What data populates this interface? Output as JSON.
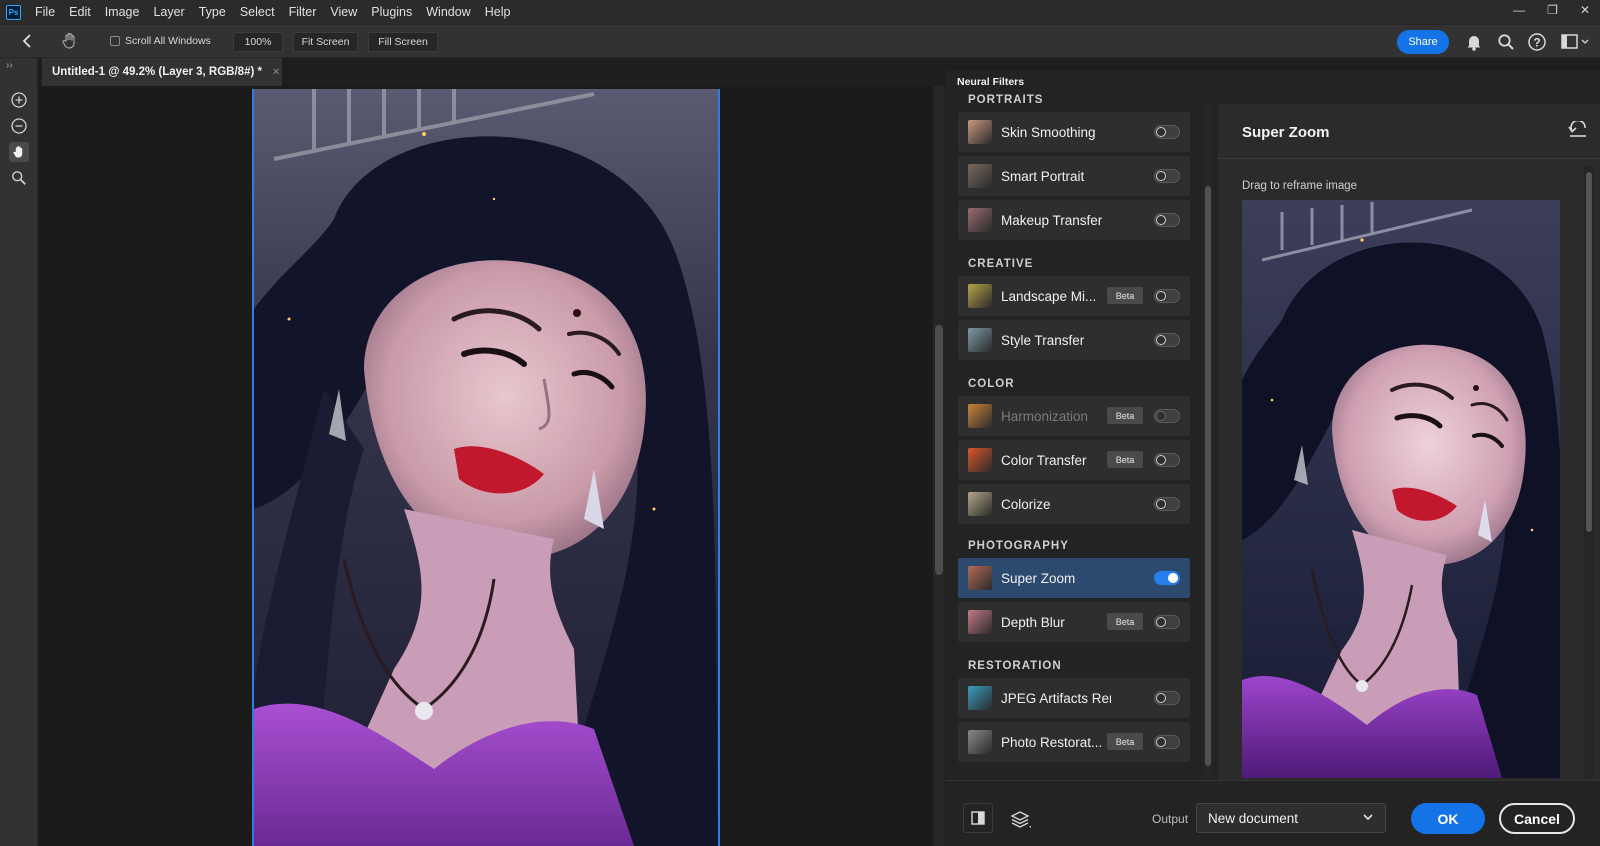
{
  "app": {
    "logo": "Ps"
  },
  "menu": [
    "File",
    "Edit",
    "Image",
    "Layer",
    "Type",
    "Select",
    "Filter",
    "View",
    "Plugins",
    "Window",
    "Help"
  ],
  "options_bar": {
    "scroll_all_windows": "Scroll All Windows",
    "zoom": "100%",
    "fit_screen": "Fit Screen",
    "fill_screen": "Fill Screen",
    "share": "Share"
  },
  "document": {
    "tab_title": "Untitled-1 @ 49.2% (Layer 3, RGB/8#) *"
  },
  "neural_filters": {
    "title": "Neural Filters",
    "categories": [
      {
        "name": "PORTRAITS",
        "filters": [
          {
            "label": "Skin Smoothing",
            "beta": "",
            "on": false,
            "disabled": false,
            "color": "#c89a80"
          },
          {
            "label": "Smart Portrait",
            "beta": "",
            "on": false,
            "disabled": false,
            "color": "#7a6a5e"
          },
          {
            "label": "Makeup Transfer",
            "beta": "",
            "on": false,
            "disabled": false,
            "color": "#9a6b72"
          }
        ]
      },
      {
        "name": "CREATIVE",
        "filters": [
          {
            "label": "Landscape Mi...",
            "beta": "Beta",
            "on": false,
            "disabled": false,
            "color": "#b7a34a"
          },
          {
            "label": "Style Transfer",
            "beta": "",
            "on": false,
            "disabled": false,
            "color": "#7e9aa8"
          }
        ]
      },
      {
        "name": "COLOR",
        "filters": [
          {
            "label": "Harmonization",
            "beta": "Beta",
            "on": false,
            "disabled": true,
            "color": "#c9853a"
          },
          {
            "label": "Color Transfer",
            "beta": "Beta",
            "on": false,
            "disabled": false,
            "color": "#d8562a"
          },
          {
            "label": "Colorize",
            "beta": "",
            "on": false,
            "disabled": false,
            "color": "#b3a78a"
          }
        ]
      },
      {
        "name": "PHOTOGRAPHY",
        "filters": [
          {
            "label": "Super Zoom",
            "beta": "",
            "on": true,
            "disabled": false,
            "color": "#b46a56",
            "selected": true
          },
          {
            "label": "Depth Blur",
            "beta": "Beta",
            "on": false,
            "disabled": false,
            "color": "#c47a8a"
          }
        ]
      },
      {
        "name": "RESTORATION",
        "filters": [
          {
            "label": "JPEG Artifacts Removal",
            "beta": "",
            "on": false,
            "disabled": false,
            "color": "#3a9ec2"
          },
          {
            "label": "Photo Restorat...",
            "beta": "Beta",
            "on": false,
            "disabled": false,
            "color": "#8a8a8a"
          }
        ]
      }
    ]
  },
  "detail": {
    "title": "Super Zoom",
    "hint": "Drag to reframe image"
  },
  "bottom": {
    "output_label": "Output",
    "output_value": "New document",
    "ok": "OK",
    "cancel": "Cancel"
  },
  "colors": {
    "accent": "#1473e6",
    "selection": "#2f7de1"
  }
}
